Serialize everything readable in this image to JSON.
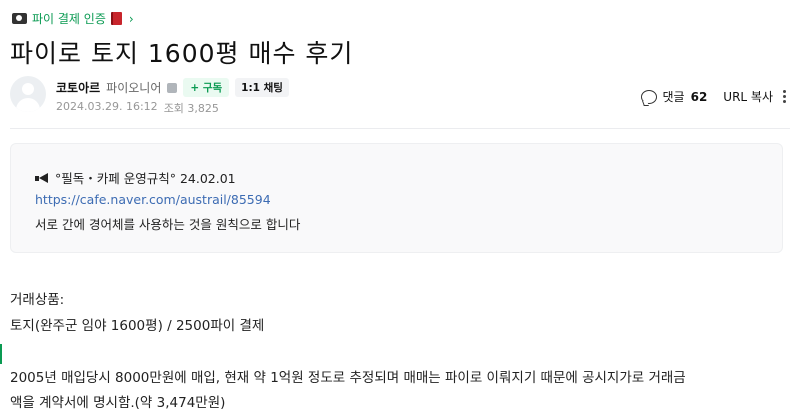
{
  "breadcrumb": {
    "label": "파이 결제 인증"
  },
  "post": {
    "title": "파이로 토지 1600평 매수 후기",
    "author": "코토아르",
    "level": "파이오니어",
    "follow_label": "+ 구독",
    "chat_label": "1:1 채팅",
    "date": "2024.03.29. 16:12",
    "views": "조회 3,825"
  },
  "tools": {
    "comment_label": "댓글",
    "comment_count": "62",
    "url_copy_label": "URL 복사"
  },
  "notice": {
    "heading": "°필독・카페 운영규칙° 24.02.01",
    "link": "https://cafe.naver.com/austrail/85594",
    "text": "서로 간에 경어체를 사용하는 것을 원칙으로 합니다"
  },
  "content": {
    "line1": "거래상품:",
    "line2": "토지(완주군 임야 1600평) / 2500파이 결제",
    "line3": "2005년 매입당시 8000만원에 매입, 현재 약 1억원 정도로 추정되며 매매는 파이로 이뤄지기 때문에 공시지가로 거래금",
    "line4": "액을 계약서에 명시함.(약 3,474만원)"
  }
}
